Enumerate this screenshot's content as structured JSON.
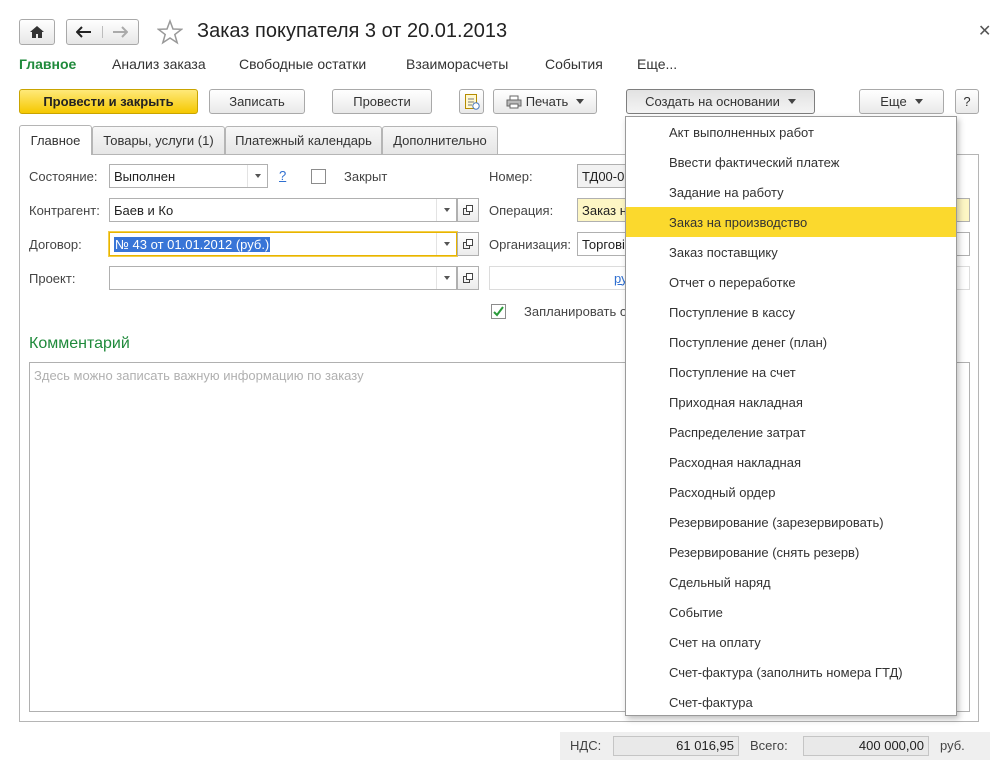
{
  "window": {
    "title": "Заказ покупателя 3 от 20.01.2013"
  },
  "section_nav": [
    "Главное",
    "Анализ заказа",
    "Свободные остатки",
    "Взаиморасчеты",
    "События",
    "Еще..."
  ],
  "toolbar": {
    "post_close": "Провести и закрыть",
    "save": "Записать",
    "post": "Провести",
    "print": "Печать",
    "create_based_on": "Создать на основании",
    "more": "Еще",
    "help": "?"
  },
  "tabs": [
    "Главное",
    "Товары, услуги (1)",
    "Платежный календарь",
    "Дополнительно"
  ],
  "form": {
    "state_label": "Состояние:",
    "state_value": "Выполнен",
    "help_link": "?",
    "closed_label": "Закрыт",
    "contractor_label": "Контрагент:",
    "contractor_value": "Баев и Ко",
    "contract_label": "Договор:",
    "contract_value": "№ 43 от 01.01.2012 (руб.)",
    "project_label": "Проект:",
    "project_value": "",
    "number_label": "Номер:",
    "number_value": "ТД00-0",
    "operation_label": "Операция:",
    "operation_value": "Заказ н",
    "organization_label": "Организация:",
    "organization_value": "Торгові",
    "currency_link": "ру",
    "plan_label": "Запланировать о",
    "plan_checked": true
  },
  "comment": {
    "title": "Комментарий",
    "placeholder": "Здесь можно записать важную информацию по заказу"
  },
  "menu": {
    "items": [
      "Акт выполненных работ",
      "Ввести фактический платеж",
      "Задание на работу",
      "Заказ на производство",
      "Заказ поставщику",
      "Отчет о переработке",
      "Поступление в кассу",
      "Поступление денег (план)",
      "Поступление на счет",
      "Приходная накладная",
      "Распределение затрат",
      "Расходная накладная",
      "Расходный ордер",
      "Резервирование (зарезервировать)",
      "Резервирование (снять резерв)",
      "Сдельный наряд",
      "Событие",
      "Счет на оплату",
      "Счет-фактура (заполнить номера ГТД)",
      "Счет-фактура"
    ],
    "highlighted": "Заказ на производство"
  },
  "totals": {
    "vat_label": "НДС:",
    "vat_value": "61 016,95",
    "total_label": "Всего:",
    "total_value": "400 000,00",
    "currency": "руб."
  },
  "colors": {
    "accent_green": "#1f8a3b",
    "primary_yellow": "#f5c800",
    "menu_highlight": "#fbd92d",
    "selection_blue": "#3875d7"
  }
}
